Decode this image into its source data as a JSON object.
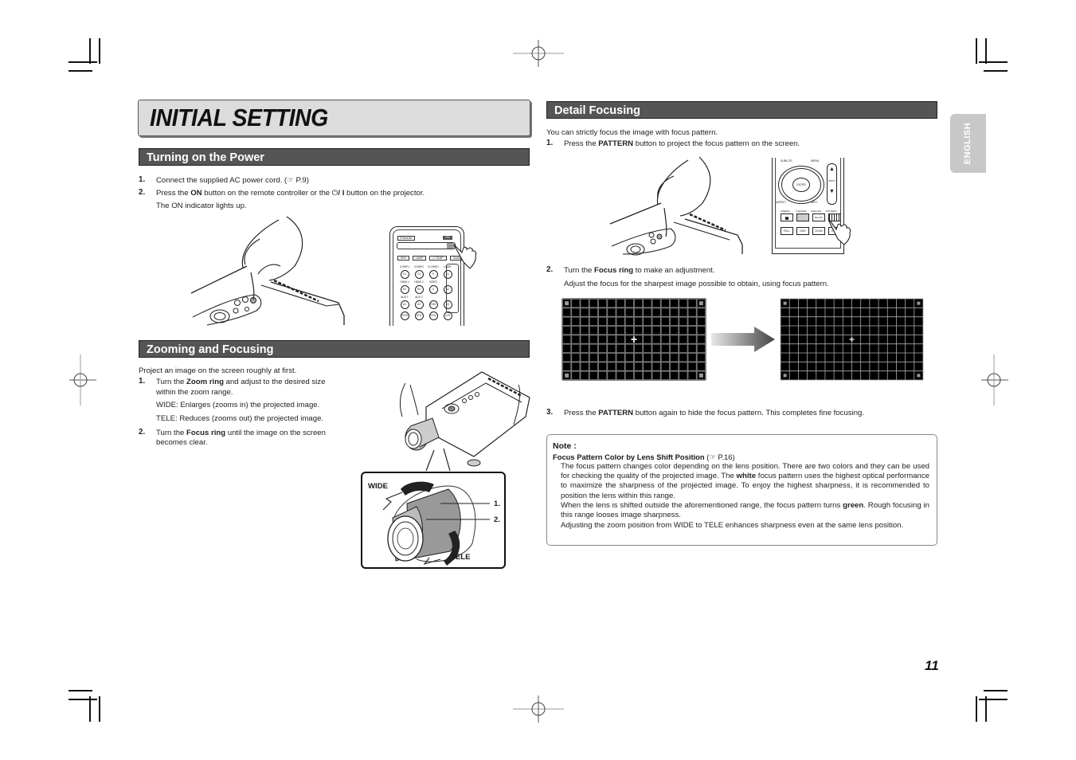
{
  "page": {
    "title": "INITIAL SETTING",
    "language_tab": "ENGLISH",
    "page_number": "11"
  },
  "power": {
    "heading": "Turning on the Power",
    "steps": [
      {
        "num": "1.",
        "pre": "Connect the supplied AC power cord. (",
        "ref_icon": "☞",
        "ref": " P.9)"
      },
      {
        "num": "2.",
        "pre": "Press the ",
        "bold": "ON",
        "mid": " button on the remote controller or the ",
        "power_symbol": "⏻",
        "bold2": "/ I",
        "post": " button on the projector."
      }
    ],
    "note_line": "The ON indicator lights up.",
    "remote_labels": {
      "top_left": "STANDBY",
      "top_right": "ON",
      "row1": [
        "IRIS",
        "LAMP",
        "C.TEMP",
        "GAMMA"
      ],
      "inputs_labels": [
        "COMP.1",
        "COMP.2",
        "S-VIDEO",
        "USER"
      ],
      "inputs_buttons": [
        "C1",
        "C2",
        "S",
        "U1"
      ],
      "hdmi_labels": [
        "HDMI 1",
        "HDMI 2",
        "VIDEO"
      ],
      "hdmi_buttons": [
        "H1",
        "H2",
        "V",
        "U2"
      ],
      "aux_labels": [
        "AUX 1",
        "AUX 2"
      ],
      "aux_buttons": [
        "A1",
        "A2",
        "RGB",
        "U3"
      ],
      "bottom_buttons": [
        "THTR",
        "STD",
        "DYN",
        "CLR"
      ]
    }
  },
  "zoom_focus": {
    "heading": "Zooming and Focusing",
    "intro": "Project an image on the screen roughly at first.",
    "step1_num": "1.",
    "step1_pre": "Turn the ",
    "step1_bold": "Zoom ring",
    "step1_post": " and adjust to the desired size",
    "step1_line2": "within the zoom range.",
    "wide_text": "WIDE: Enlarges (zooms in) the projected image.",
    "tele_text": "TELE: Reduces (zooms out) the projected image.",
    "step2_num": "2.",
    "step2_pre": "Turn the ",
    "step2_bold": "Focus ring",
    "step2_post": " until the image on the screen",
    "step2_line2": "becomes clear.",
    "callout": {
      "wide": "WIDE",
      "tele": "TELE",
      "label1": "1.",
      "label2": "2."
    }
  },
  "detail": {
    "heading": "Detail Focusing",
    "intro": "You can strictly focus the image with focus pattern.",
    "step1_num": "1.",
    "step1_pre": "Press the ",
    "step1_bold": "PATTERN",
    "step1_post": " button to project the focus pattern on the screen.",
    "remote_labels": {
      "top": [
        "SUBLITE",
        "MENU"
      ],
      "enter": "ENTER",
      "side": [
        "ASPECT",
        "INFO."
      ],
      "input": "INPUT",
      "row": [
        "CINEMA",
        "V-RANGE",
        "SLEG.ES",
        "PATTERN"
      ],
      "row_buttons": [
        "",
        "",
        "BLACK",
        ""
      ],
      "bottom": [
        "FULL",
        "NOR",
        "ZOOM",
        "THRU"
      ]
    },
    "step2_num": "2.",
    "step2_pre": "Turn the ",
    "step2_bold": "Focus ring",
    "step2_post": " to make an adjustment.",
    "step2_line2": "Adjust the focus for the sharpest image possible to obtain, using focus pattern.",
    "pattern": {
      "columns": 16,
      "rows": 9,
      "before": "blurred",
      "after": "sharp"
    },
    "step3_num": "3.",
    "step3_pre": "Press the ",
    "step3_bold": "PATTERN",
    "step3_post": " button again to hide the focus pattern. This completes fine focusing."
  },
  "note": {
    "label": "Note :",
    "subtitle": "Focus Pattern Color by Lens Shift Position",
    "subtitle_ref_pre": " (",
    "ref_icon": "☞",
    "subtitle_ref": " P.16)",
    "p1_a": "The focus pattern changes color depending on the lens position. There are two colors and they can be used for checking the quality of the projected image. The ",
    "p1_bold": "white",
    "p1_b": " focus pattern uses the highest optical performance to maximize the sharpness of the projected image. To enjoy the highest sharpness, it is recommended to position the lens within this range.",
    "p2_a": "When the lens is shifted outside the aforementioned range, the focus pattern turns ",
    "p2_bold": "green",
    "p2_b": ". Rough focusing in this range looses image sharpness.",
    "p3": "Adjusting the zoom position from WIDE to TELE enhances sharpness even at the same lens position."
  },
  "colors": {
    "section_header_bg": "#555555",
    "title_bg": "#dcdcdc",
    "language_tab_bg": "#c8c8c8",
    "pattern_bg": "#000000"
  }
}
